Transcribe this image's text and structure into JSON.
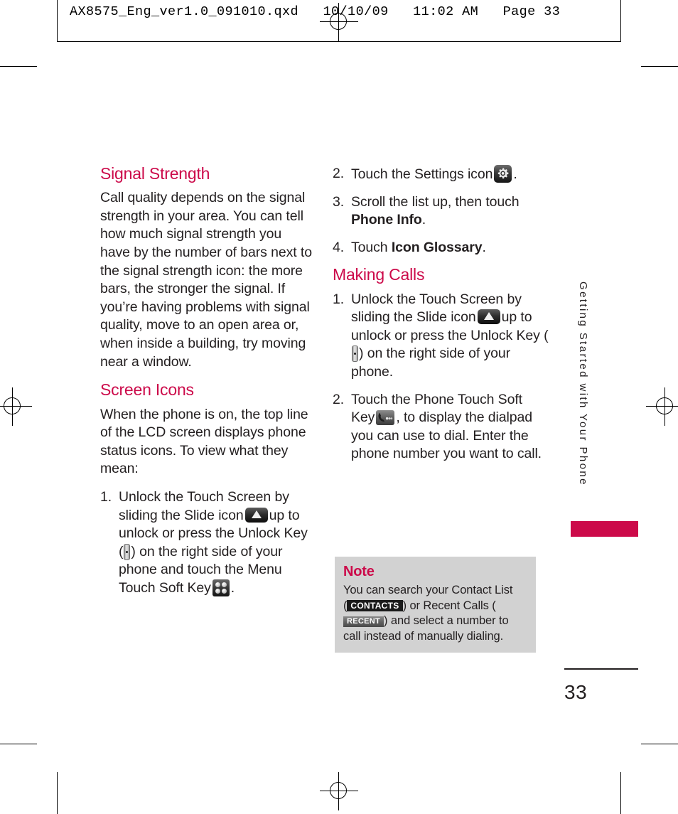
{
  "slug": {
    "text": "AX8575_Eng_ver1.0_091010.qxd   10/10/09   11:02 AM   Page 33"
  },
  "colors": {
    "accent": "#cc0a4a",
    "text": "#231f20",
    "note_bg": "#d2d2d2"
  },
  "left_column": {
    "heading_1": "Signal Strength",
    "paragraph_1": "Call quality depends on the signal strength in your area. You can tell how much signal strength you have by the number of bars next to the signal strength icon: the more bars, the stronger the signal. If you’re having problems with signal quality, move to an open area or, when inside a building, try moving near a window.",
    "heading_2": "Screen Icons",
    "paragraph_2": "When the phone is on, the top line of the LCD screen displays phone status icons. To view what they mean:",
    "step_1": {
      "number": "1.",
      "part_a": "Unlock the Touch Screen by sliding the Slide icon",
      "part_b": "up to unlock or press the Unlock Key (",
      "part_c": ") on the right side of your phone and touch the Menu Touch Soft Key",
      "part_d": "."
    }
  },
  "right_column": {
    "step_2": {
      "number": "2.",
      "part_a": "Touch the Settings icon",
      "part_b": "."
    },
    "step_3": {
      "number": "3.",
      "part_a": "Scroll the list up, then touch ",
      "bold": "Phone Info",
      "part_b": "."
    },
    "step_4": {
      "number": "4.",
      "part_a": "Touch ",
      "bold": "Icon Glossary",
      "part_b": "."
    },
    "heading_1": "Making Calls",
    "making_step_1": {
      "number": "1.",
      "part_a": "Unlock the Touch Screen by sliding the Slide icon",
      "part_b": "up to unlock or press the Unlock Key (",
      "part_c": ") on the right side of your phone."
    },
    "making_step_2": {
      "number": "2.",
      "part_a": "Touch the Phone Touch Soft Key",
      "part_b": ", to display the dialpad you can use to dial. Enter the phone number you want to call."
    }
  },
  "note": {
    "title": "Note",
    "line_1": "You can search your Contact List",
    "paren_open": "(",
    "badge_contacts": "CONTACTS",
    "mid": ") or Recent Calls (",
    "badge_recent": "RECENT",
    "paren_close": ")",
    "line_3": "and select a number to call instead of manually dialing."
  },
  "side_tab": {
    "label": "Getting Started with Your Phone"
  },
  "folio": {
    "page_number": "33"
  },
  "icons": {
    "slide": "slide-up-icon",
    "unlock_key": "unlock-key-icon",
    "menu_soft_key": "menu-soft-key-icon",
    "settings": "settings-gear-icon",
    "phone_soft_key": "phone-soft-key-icon"
  }
}
